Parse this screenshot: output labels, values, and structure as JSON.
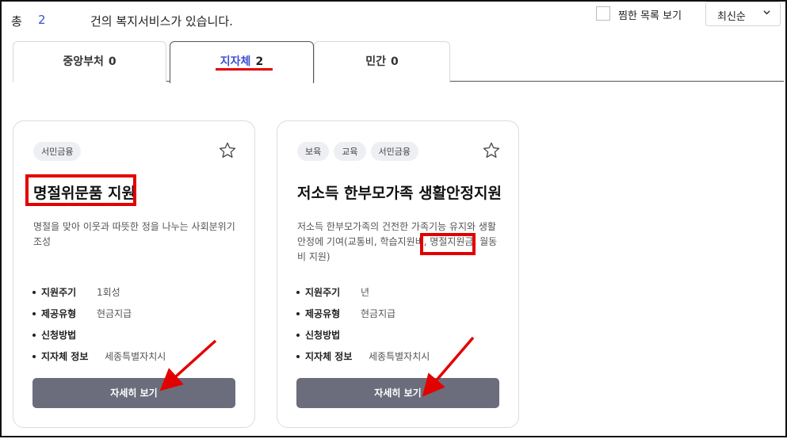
{
  "summary": {
    "prefix": "총",
    "count": "2",
    "suffix": "건의 복지서비스가 있습니다."
  },
  "favorites_toggle": {
    "label": "찜한 목록 보기"
  },
  "sort": {
    "selected": "최신순"
  },
  "tabs": [
    {
      "label": "중앙부처",
      "count": "0"
    },
    {
      "label": "지자체",
      "count": "2",
      "active": true
    },
    {
      "label": "민간",
      "count": "0"
    }
  ],
  "cards": [
    {
      "tags": [
        "서민금융"
      ],
      "title": "명절위문품 지원",
      "description": "명절을 맞아 이웃과 따뜻한 정을 나누는 사회분위기 조성",
      "info": [
        {
          "label": "지원주기",
          "value": "1회성"
        },
        {
          "label": "제공유형",
          "value": "현금지급"
        },
        {
          "label": "신청방법",
          "value": ""
        },
        {
          "label": "지자체 정보",
          "value": "세종특별자치시"
        }
      ],
      "button_label": "자세히 보기"
    },
    {
      "tags": [
        "보육",
        "교육",
        "서민금융"
      ],
      "title": "저소득 한부모가족 생활안정지원",
      "description": "저소득 한부모가족의 건전한 가족기능 유지와 생활 안정에 기여(교통비, 학습지원비, 명절지원금, 월동비 지원)",
      "info": [
        {
          "label": "지원주기",
          "value": "년"
        },
        {
          "label": "제공유형",
          "value": "현금지급"
        },
        {
          "label": "신청방법",
          "value": ""
        },
        {
          "label": "지자체 정보",
          "value": "세종특별자치시"
        }
      ],
      "button_label": "자세히 보기"
    }
  ],
  "colors": {
    "accent": "#3a4fd1",
    "highlight": "#e30000",
    "button": "#6b6d7c"
  },
  "icons": [
    "checkbox-icon",
    "chevron-down-icon",
    "star-outline-icon",
    "red-arrow-annotation"
  ]
}
